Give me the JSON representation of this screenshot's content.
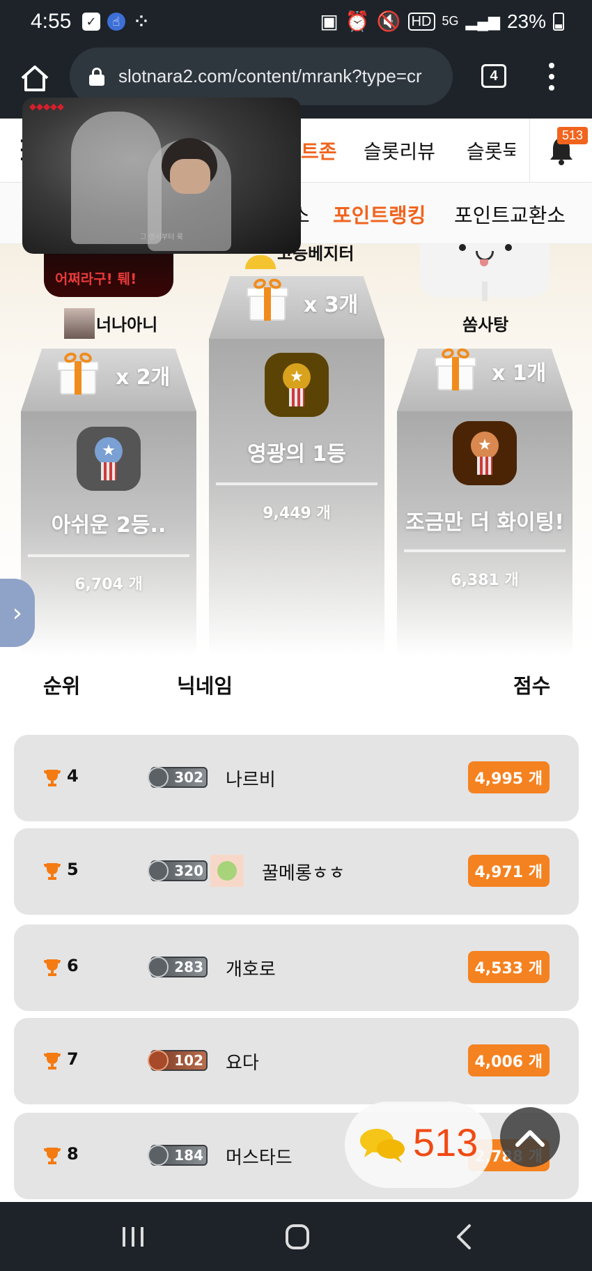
{
  "status_bar": {
    "time": "4:55",
    "battery": "23%",
    "network": "5G"
  },
  "browser": {
    "url": "slotnara2.com/content/mrank?type=cr",
    "tab_count": "4"
  },
  "site_nav": {
    "items": [
      "트존",
      "슬롯리뷰",
      "슬롯묵"
    ],
    "notification_count": "513"
  },
  "sub_nav": {
    "items": [
      "소",
      "포인트랭킹",
      "포인트교환소"
    ]
  },
  "video": {
    "logo_text": "◆◆◆◆◆",
    "caption": "그 앤서부터 룩"
  },
  "podium": {
    "first": {
      "name": "고능베지터",
      "gift_count": "x 3개",
      "title": "영광의 1등",
      "score": "9,449 개",
      "medal_color": "#d8a21c",
      "tile_color": "#5a4304"
    },
    "second": {
      "name": "너나아니",
      "avatar_text": "어쩌라구! 퉤!",
      "gift_count": "x 2개",
      "title": "아쉬운 2등..",
      "score": "6,704 개",
      "medal_color": "#7aa0d4",
      "tile_color": "#555555"
    },
    "third": {
      "name": "쏨사탕",
      "gift_count": "x 1개",
      "title": "조금만 더 화이팅!",
      "score": "6,381 개",
      "medal_color": "#d9884f",
      "tile_color": "#4a2404"
    }
  },
  "table": {
    "headers": {
      "rank": "순위",
      "nickname": "닉네임",
      "score": "점수"
    },
    "rows": [
      {
        "rank": "4",
        "level": "302",
        "nickname": "나르비",
        "score": "4,995 개",
        "badge": "silver",
        "has_avatar": false
      },
      {
        "rank": "5",
        "level": "320",
        "nickname": "꿀메롱ㅎㅎ",
        "score": "4,971 개",
        "badge": "silver",
        "has_avatar": true
      },
      {
        "rank": "6",
        "level": "283",
        "nickname": "개호로",
        "score": "4,533 개",
        "badge": "silver",
        "has_avatar": false
      },
      {
        "rank": "7",
        "level": "102",
        "nickname": "요다",
        "score": "4,006 개",
        "badge": "bronze",
        "has_avatar": false
      },
      {
        "rank": "8",
        "level": "184",
        "nickname": "머스타드",
        "score": "2,788 개",
        "badge": "silver",
        "has_avatar": false
      }
    ]
  },
  "chat_float": {
    "count": "513"
  },
  "colors": {
    "accent": "#f0641e",
    "score_badge": "#f58220",
    "chrome": "#1d2329"
  }
}
